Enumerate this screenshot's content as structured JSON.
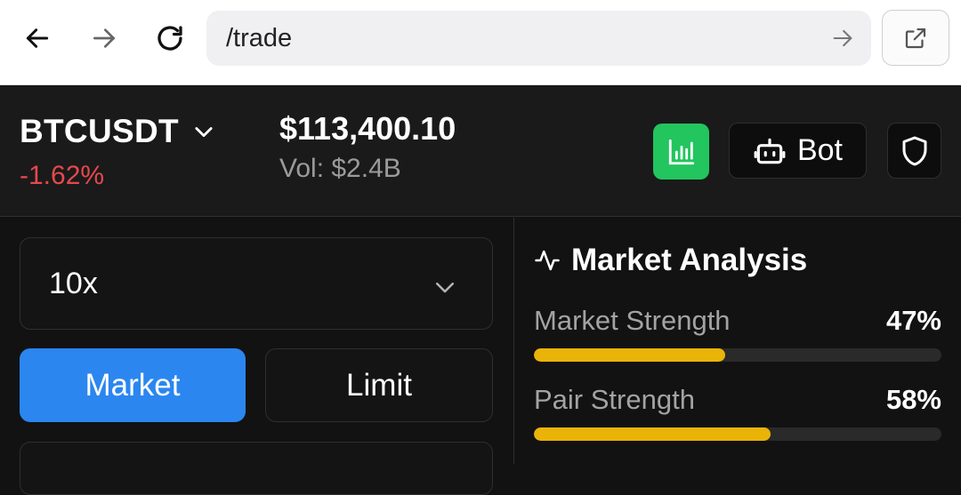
{
  "browser": {
    "url": "/trade",
    "icons": {
      "back": "arrow-left-icon",
      "forward": "arrow-right-icon",
      "reload": "reload-icon",
      "go": "arrow-right-icon",
      "open_external": "external-link-icon"
    }
  },
  "header": {
    "symbol": "BTCUSDT",
    "change": "-1.62%",
    "price": "$113,400.10",
    "volume": "Vol: $2.4B",
    "bot_label": "Bot",
    "colors": {
      "negative": "#e5484d",
      "chart_button": "#22c55e"
    }
  },
  "order": {
    "leverage": "10x",
    "types": [
      "Market",
      "Limit"
    ],
    "active_type": "Market",
    "accent": "#2b86f0"
  },
  "analysis": {
    "title": "Market Analysis",
    "metrics": [
      {
        "label": "Market Strength",
        "value_text": "47%",
        "value": 47
      },
      {
        "label": "Pair Strength",
        "value_text": "58%",
        "value": 58
      }
    ],
    "bar_color": "#eab308"
  }
}
